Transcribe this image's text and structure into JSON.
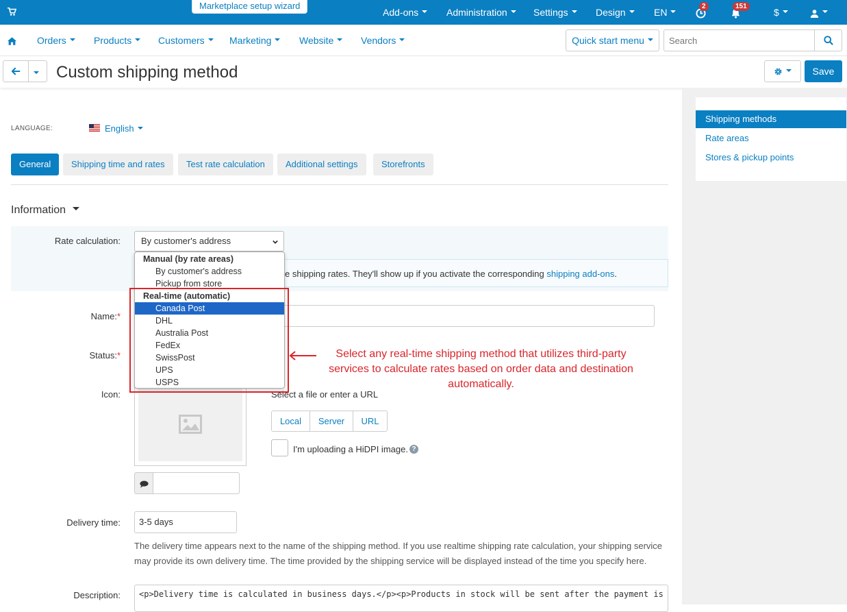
{
  "topbar": {
    "wizard": "Marketplace setup wizard",
    "items": [
      "Add-ons",
      "Administration",
      "Settings",
      "Design",
      "EN"
    ],
    "badges": {
      "orders": "2",
      "notifications": "151"
    },
    "currency": "$"
  },
  "nav": {
    "items": [
      "Orders",
      "Products",
      "Customers",
      "Marketing",
      "Website",
      "Vendors"
    ],
    "quick_start": "Quick start menu",
    "search_placeholder": "Search"
  },
  "page": {
    "title": "Custom shipping method",
    "save": "Save"
  },
  "sidebar": {
    "items": [
      "Shipping methods",
      "Rate areas",
      "Stores & pickup points"
    ]
  },
  "language": {
    "label": "LANGUAGE:",
    "value": "English"
  },
  "tabs": [
    "General",
    "Shipping time and rates",
    "Test rate calculation",
    "Additional settings",
    "Storefronts"
  ],
  "section": {
    "title": "Information"
  },
  "form": {
    "rate_label": "Rate calculation:",
    "rate_value": "By customer's address",
    "info_text": "e shipping rates. They'll show up if you activate the corresponding ",
    "info_link": "shipping add-ons",
    "info_end": ".",
    "name_label": "Name:",
    "status_label": "Status:",
    "icon_label": "Icon:",
    "file_label": "Select a file or enter a URL",
    "file_sources": [
      "Local",
      "Server",
      "URL"
    ],
    "hidpi_label": "I'm uploading a HiDPI image.",
    "delivery_label": "Delivery time:",
    "delivery_value": "3-5 days",
    "delivery_help": "The delivery time appears next to the name of the shipping method. If you use realtime shipping rate calculation, your shipping service may provide its own delivery time. The time provided by the shipping service will be displayed instead of the time you specify here.",
    "description_label": "Description:",
    "description_value": "<p>Delivery time is calculated in business days.</p><p>Products in stock will be sent after the payment is verified. Mail service is"
  },
  "dropdown": {
    "group_manual": "Manual (by rate areas)",
    "manual_options": [
      "By customer's address",
      "Pickup from store"
    ],
    "group_realtime": "Real-time (automatic)",
    "realtime_options": [
      "Canada Post",
      "DHL",
      "Australia Post",
      "FedEx",
      "SwissPost",
      "UPS",
      "USPS"
    ],
    "selected": "Canada Post"
  },
  "annotation": {
    "text": "Select any real-time shipping method that utilizes third-party services to calculate rates based on order data and destination automatically.",
    "color": "#d8252b"
  },
  "colors": {
    "brand": "#0a7fc2",
    "highlight": "#1f67c7"
  }
}
